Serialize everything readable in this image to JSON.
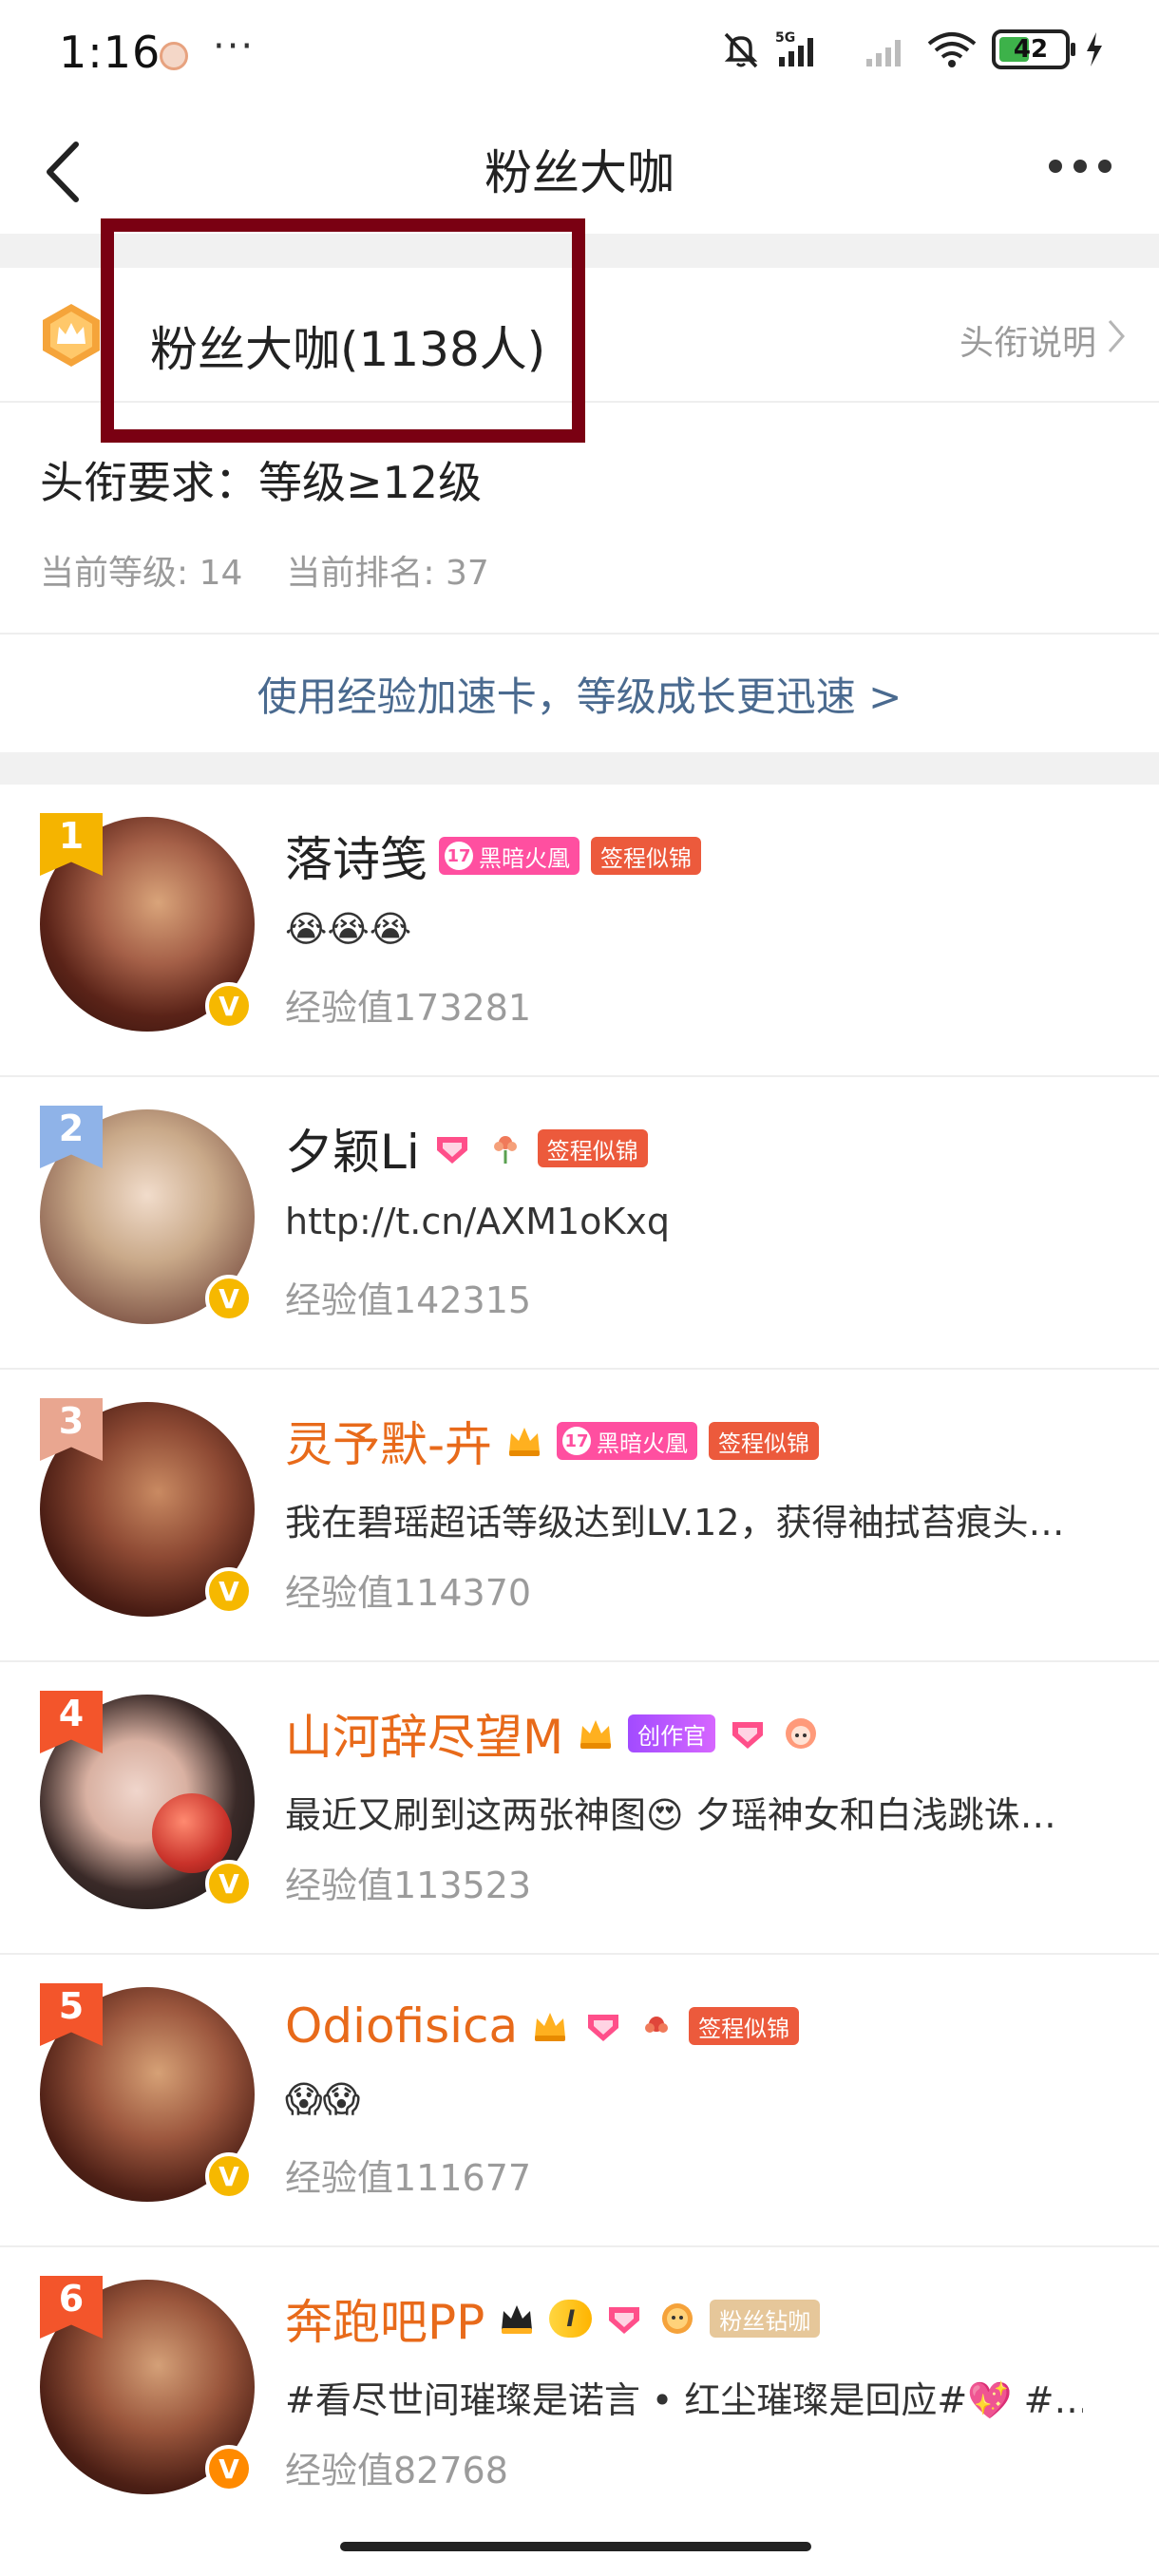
{
  "status_bar": {
    "time": "1:16",
    "dots": "···",
    "battery": "42"
  },
  "nav": {
    "title": "粉丝大咖"
  },
  "title_card": {
    "title": "粉丝大咖(1138人)",
    "explain_link": "头衔说明",
    "requirement": "头衔要求：等级≥12级",
    "current_level": "当前等级: 14",
    "current_rank": "当前排名: 37",
    "boost_link": "使用经验加速卡，等级成长更迅速 >"
  },
  "ranking": [
    {
      "rank": "1",
      "rank_color": "#f5b400",
      "name": "落诗笺",
      "name_color": "default",
      "badge_pink": "黑暗火凰",
      "badge_pink_level": "17",
      "badge_red": "签程似锦",
      "desc": "😭😭😭",
      "exp": "经验值173281",
      "avatar_colors": [
        "#7a3a2c",
        "#d9a47a",
        "#3c1a14"
      ]
    },
    {
      "rank": "2",
      "rank_color": "#8fb3e8",
      "name": "夕颖Li",
      "name_color": "default",
      "badge_red": "签程似锦",
      "desc": "http://t.cn/AXM1oKxq",
      "exp": "经验值142315",
      "avatar_colors": [
        "#c9a989",
        "#f1dccb",
        "#8a6150"
      ]
    },
    {
      "rank": "3",
      "rank_color": "#e9a690",
      "name": "灵予默-卉",
      "name_color": "orange",
      "badge_pink": "黑暗火凰",
      "badge_pink_level": "17",
      "badge_red": "签程似锦",
      "desc": "我在碧瑶超话等级达到LV.12，获得袖拭苔痕头…",
      "exp": "经验值114370",
      "avatar_colors": [
        "#5e2a20",
        "#c98a62",
        "#2c120d"
      ]
    },
    {
      "rank": "4",
      "rank_color": "#f3552b",
      "name": "山河辞尽望M",
      "name_color": "orange",
      "badge_purple": "创作官",
      "desc": "最近又刷到这两张神图😍 夕瑶神女和白浅跳诛…",
      "exp": "经验值113523",
      "avatar_colors": [
        "#1a1a1a",
        "#f0d6cc",
        "#c9322a"
      ]
    },
    {
      "rank": "5",
      "rank_color": "#f3552b",
      "name": "Odiofisica",
      "name_color": "orange",
      "badge_red": "签程似锦",
      "desc": "😱😱",
      "exp": "经验值111677",
      "avatar_colors": [
        "#6b3022",
        "#d6a176",
        "#2e130e"
      ]
    },
    {
      "rank": "6",
      "rank_color": "#f3552b",
      "name": "奔跑吧PP",
      "name_color": "orange",
      "level_pill": "I",
      "badge_gold": "粉丝钻咖",
      "desc": "#看尽世间璀璨是诺言 • 红尘璀璨是回应#💖 #…",
      "exp": "经验值82768",
      "avatar_colors": [
        "#6a2e22",
        "#d4a078",
        "#2a110c"
      ]
    }
  ]
}
